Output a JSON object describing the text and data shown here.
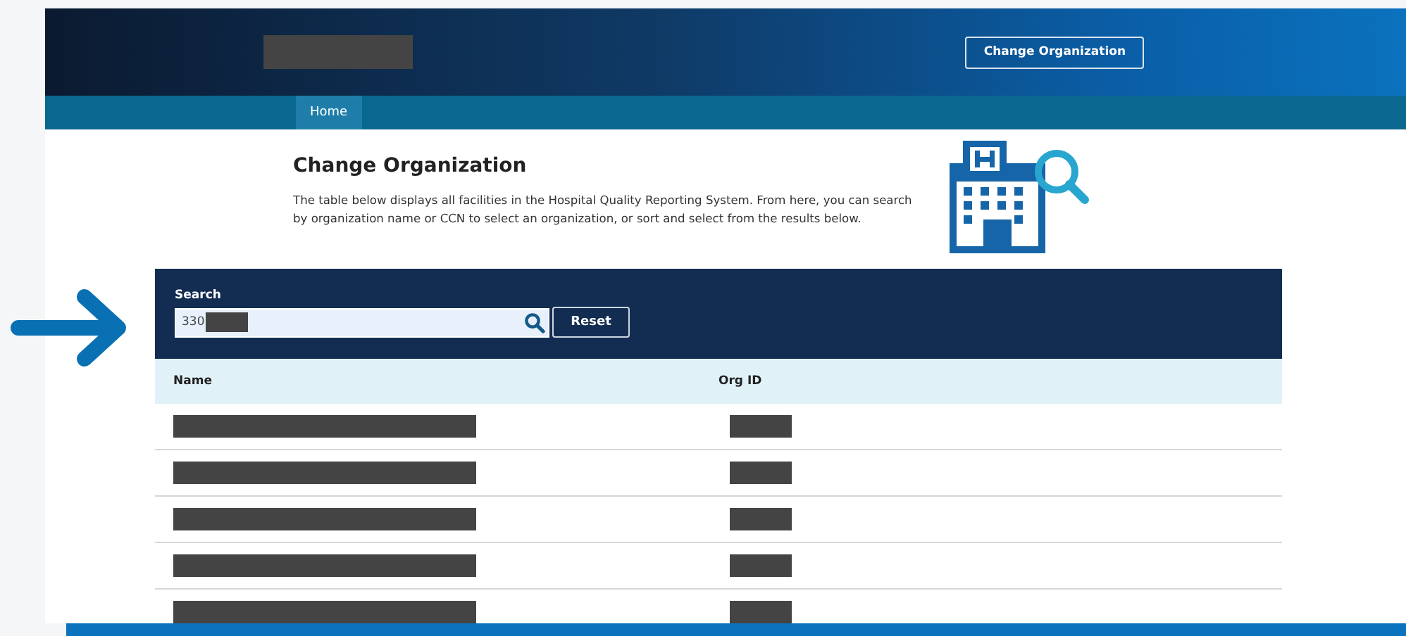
{
  "header": {
    "logo_redacted": true,
    "button": "Change Organization"
  },
  "nav": {
    "tabs": [
      {
        "label": "Home",
        "selected": true
      }
    ]
  },
  "page": {
    "title": "Change Organization",
    "description": "The table below displays all facilities in the Hospital Quality Reporting System. From here, you can search by organization name or CCN to select an organization, or sort and select from the results below."
  },
  "search": {
    "label": "Search",
    "value": "330",
    "value_redacted": true,
    "reset_button": "Reset"
  },
  "table": {
    "columns": [
      "Name",
      "Org ID"
    ],
    "rows": [
      {
        "name_redacted": true,
        "org_id_redacted": true
      },
      {
        "name_redacted": true,
        "org_id_redacted": true
      },
      {
        "name_redacted": true,
        "org_id_redacted": true
      },
      {
        "name_redacted": true,
        "org_id_redacted": true
      },
      {
        "name_redacted": true,
        "org_id_redacted": true
      }
    ]
  }
}
